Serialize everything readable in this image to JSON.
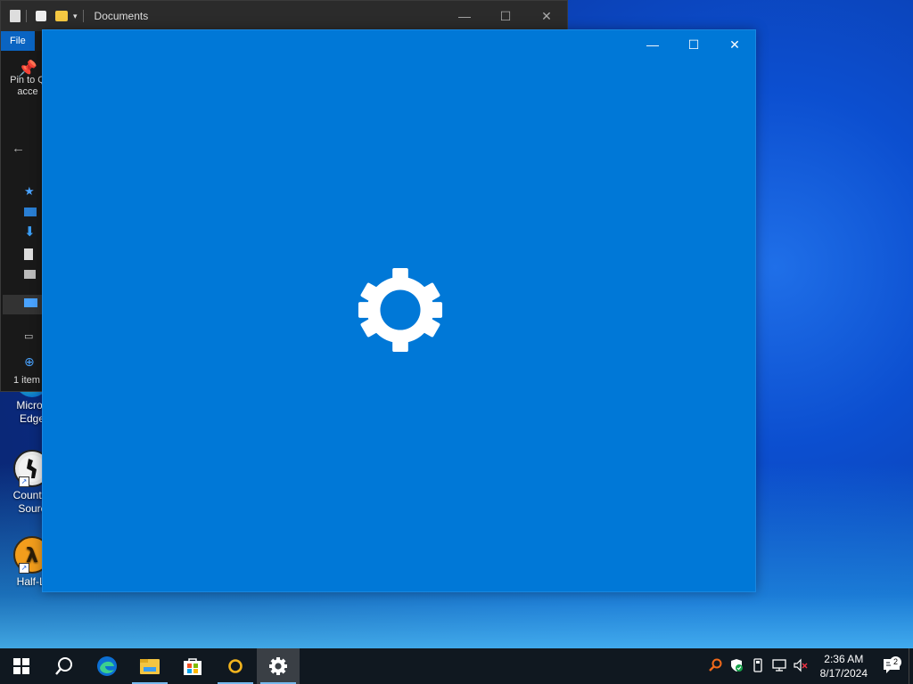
{
  "explorer": {
    "title": "Documents",
    "file_tab": "File",
    "pin_label_line1": "Pin to Q",
    "pin_label_line2": "acce",
    "status": "1 item",
    "controls": {
      "minimize": "—",
      "maximize": "☐",
      "close": "✕"
    }
  },
  "desktop": {
    "icons": [
      {
        "label_line1": "Micros",
        "label_line2": "Edge"
      },
      {
        "label_line1": "Counter",
        "label_line2": "Sourc"
      },
      {
        "label_line1": "Half-Li",
        "label_line2": ""
      }
    ]
  },
  "settings_window": {
    "controls": {
      "minimize": "—",
      "maximize": "☐",
      "close": "✕"
    },
    "splash_icon": "gear-icon",
    "background_color": "#0078d7"
  },
  "taskbar": {
    "apps": [
      "start-icon",
      "search-icon",
      "edge-icon",
      "file-explorer-icon",
      "store-icon",
      "circle-app-icon",
      "settings-icon"
    ],
    "clock": {
      "time": "2:36 AM",
      "date": "8/17/2024"
    },
    "notification_count": "2",
    "tray_icons": [
      "search-tray-icon",
      "security-icon",
      "usb-icon",
      "network-icon",
      "volume-muted-icon"
    ]
  }
}
